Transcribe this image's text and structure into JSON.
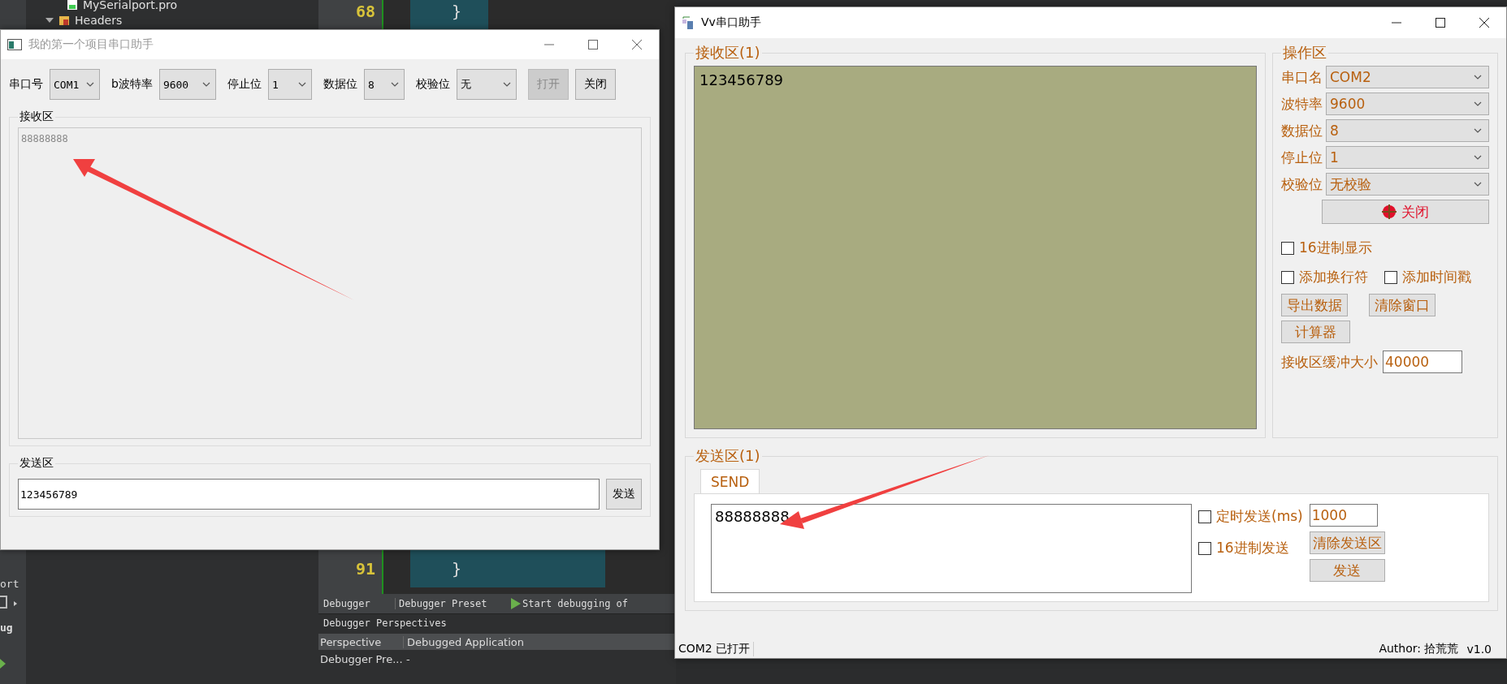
{
  "ide": {
    "tree_items": [
      {
        "label": "MySerialport.pro",
        "kind": "file"
      },
      {
        "label": "Headers",
        "kind": "folder",
        "expanded": true
      }
    ],
    "code_lines": [
      {
        "number": "68",
        "text": "}"
      },
      {
        "number": "91",
        "text": "}"
      }
    ],
    "side_labels": [
      "ort",
      "ug"
    ],
    "debugger_bar": {
      "perspective": "Debugger",
      "preset": "Debugger Preset",
      "start": "Start debugging of"
    },
    "perspectives": {
      "title": "Debugger Perspectives",
      "columns": [
        "Perspective",
        "Debugged Application"
      ],
      "rows": [
        [
          "Debugger Pre...",
          "-"
        ]
      ]
    }
  },
  "left_window": {
    "title": "我的第一个项目串口助手",
    "settings": [
      {
        "label": "串口号",
        "value": "COM1"
      },
      {
        "label": "b波特率",
        "value": "9600"
      },
      {
        "label": "停止位",
        "value": "1"
      },
      {
        "label": "数据位",
        "value": "8"
      },
      {
        "label": "校验位",
        "value": "无"
      }
    ],
    "buttons": [
      {
        "label": "打开",
        "disabled": true
      },
      {
        "label": "关闭",
        "disabled": false
      }
    ],
    "receive": {
      "title": "接收区",
      "text": "88888888"
    },
    "send": {
      "title": "发送区",
      "value": "123456789",
      "button": "发送"
    }
  },
  "right_window": {
    "title": "Vv串口助手",
    "receive": {
      "title": "接收区(1)",
      "text": "123456789"
    },
    "controls": {
      "title": "操作区",
      "settings": [
        {
          "label": "串口名",
          "value": "COM2"
        },
        {
          "label": "波特率",
          "value": "9600"
        },
        {
          "label": "数据位",
          "value": "8"
        },
        {
          "label": "停止位",
          "value": "1"
        },
        {
          "label": "校验位",
          "value": "无校验"
        }
      ],
      "toggle_button": "关闭",
      "checkboxes": [
        {
          "label": "16进制显示",
          "checked": false
        },
        {
          "label": "添加换行符",
          "checked": false
        },
        {
          "label": "添加时间戳",
          "checked": false
        }
      ],
      "buttons": [
        "导出数据",
        "清除窗口",
        "计算器"
      ],
      "buffer": {
        "label": "接收区缓冲大小",
        "value": "40000"
      }
    },
    "send": {
      "title": "发送区(1)",
      "tabs": [
        {
          "label": "SEND",
          "selected": true
        }
      ],
      "text": "88888888",
      "timed": {
        "label": "定时发送(ms)",
        "checked": false,
        "value": "1000"
      },
      "hex": {
        "label": "16进制发送",
        "checked": false
      },
      "clear_button": "清除发送区",
      "send_button": "发送"
    },
    "status": {
      "text": "COM2 已打开",
      "author": "Author: 拾荒荒",
      "version": "v1.0"
    }
  }
}
